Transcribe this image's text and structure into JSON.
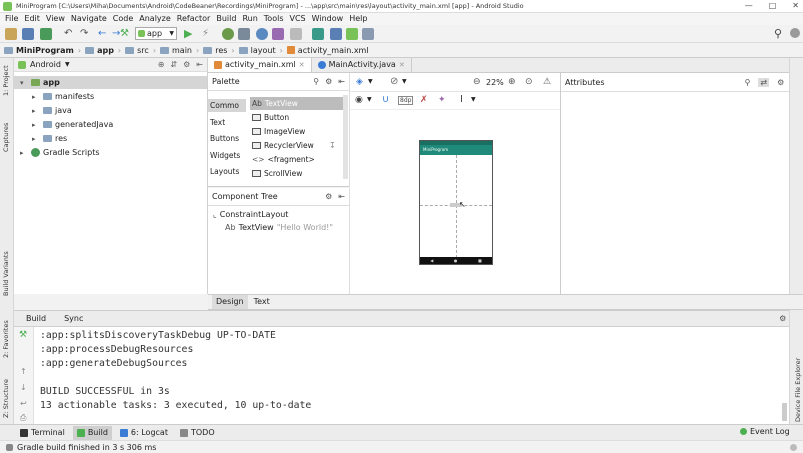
{
  "window": {
    "title": "MiniProgram [C:\\Users\\Miha\\Documents\\Android\\CodeBeaner\\Recordings\\MiniProgram] - ...\\app\\src\\main\\res\\layout\\activity_main.xml [app] - Android Studio"
  },
  "menu": [
    "File",
    "Edit",
    "View",
    "Navigate",
    "Code",
    "Analyze",
    "Refactor",
    "Build",
    "Run",
    "Tools",
    "VCS",
    "Window",
    "Help"
  ],
  "toolbar": {
    "run_config": "app"
  },
  "breadcrumb": [
    "MiniProgram",
    "app",
    "src",
    "main",
    "res",
    "layout",
    "activity_main.xml"
  ],
  "left_strip": {
    "project": "1: Project",
    "captures": "Captures",
    "build_variants": "Build Variants",
    "favorites": "2: Favorites",
    "structure": "Z: Structure"
  },
  "project": {
    "view_selector": "Android",
    "tree": [
      {
        "label": "app",
        "indent": 0,
        "expanded": true
      },
      {
        "label": "manifests",
        "indent": 1,
        "expanded": false
      },
      {
        "label": "java",
        "indent": 1,
        "expanded": false
      },
      {
        "label": "generatedJava",
        "indent": 1,
        "expanded": false
      },
      {
        "label": "res",
        "indent": 1,
        "expanded": false
      },
      {
        "label": "Gradle Scripts",
        "indent": 0,
        "expanded": false
      }
    ]
  },
  "editor_tabs": [
    {
      "label": "activity_main.xml",
      "active": true
    },
    {
      "label": "MainActivity.java",
      "active": false
    }
  ],
  "palette": {
    "title": "Palette",
    "categories": [
      "Commo",
      "Text",
      "Buttons",
      "Widgets",
      "Layouts"
    ],
    "items": [
      {
        "label": "TextView",
        "prefix": "Ab"
      },
      {
        "label": "Button",
        "prefix": ""
      },
      {
        "label": "ImageView",
        "prefix": ""
      },
      {
        "label": "RecyclerView",
        "prefix": ""
      },
      {
        "label": "<fragment>",
        "prefix": "<>"
      },
      {
        "label": "ScrollView",
        "prefix": ""
      }
    ]
  },
  "design_toolbar": {
    "zoom": "22%"
  },
  "phone": {
    "app_title": "MiniProgram"
  },
  "component_tree": {
    "title": "Component Tree",
    "root": "ConstraintLayout",
    "child_prefix": "Ab",
    "child": "TextView",
    "child_text": "\"Hello World!\""
  },
  "attributes": {
    "title": "Attributes"
  },
  "design_tabs": [
    {
      "label": "Design",
      "active": true
    },
    {
      "label": "Text",
      "active": false
    }
  ],
  "build": {
    "tabs": [
      "Build",
      "Sync"
    ],
    "console": [
      ":app:splitsDiscoveryTaskDebug UP-TO-DATE",
      ":app:processDebugResources",
      ":app:generateDebugSources",
      "",
      "BUILD SUCCESSFUL in 3s",
      "13 actionable tasks: 3 executed, 10 up-to-date"
    ]
  },
  "right_strip": {
    "device_explorer": "Device File Explorer"
  },
  "tool_windows": [
    {
      "label": "Terminal",
      "active": false
    },
    {
      "label": "Build",
      "active": true
    },
    {
      "label": "6: Logcat",
      "active": false
    },
    {
      "label": "TODO",
      "active": false
    }
  ],
  "event_log": "Event Log",
  "status": "Gradle build finished in 3 s 306 ms",
  "colors": {
    "android_green": "#78c257",
    "toolbar_teal": "#1f8a7a",
    "accent_blue": "#3a7bd5",
    "success_green": "#4caf50"
  }
}
